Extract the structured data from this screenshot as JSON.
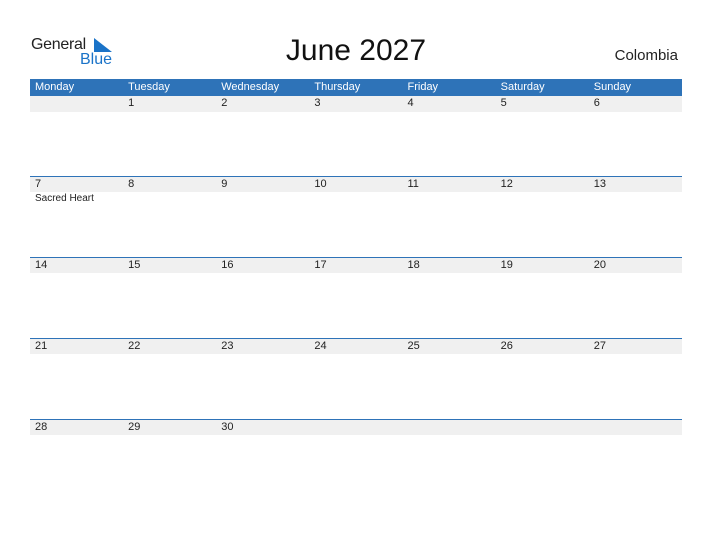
{
  "logo": {
    "general": "General",
    "blue": "Blue",
    "accent": "#1a73c8"
  },
  "title": "June 2027",
  "country": "Colombia",
  "colors": {
    "header_bg": "#2e73b8",
    "row_bg": "#f0f0f0"
  },
  "weekdays": [
    "Monday",
    "Tuesday",
    "Wednesday",
    "Thursday",
    "Friday",
    "Saturday",
    "Sunday"
  ],
  "weeks": [
    {
      "days": [
        "",
        "1",
        "2",
        "3",
        "4",
        "5",
        "6"
      ],
      "events": [
        "",
        "",
        "",
        "",
        "",
        "",
        ""
      ]
    },
    {
      "days": [
        "7",
        "8",
        "9",
        "10",
        "11",
        "12",
        "13"
      ],
      "events": [
        "Sacred Heart",
        "",
        "",
        "",
        "",
        "",
        ""
      ]
    },
    {
      "days": [
        "14",
        "15",
        "16",
        "17",
        "18",
        "19",
        "20"
      ],
      "events": [
        "",
        "",
        "",
        "",
        "",
        "",
        ""
      ]
    },
    {
      "days": [
        "21",
        "22",
        "23",
        "24",
        "25",
        "26",
        "27"
      ],
      "events": [
        "",
        "",
        "",
        "",
        "",
        "",
        ""
      ]
    },
    {
      "days": [
        "28",
        "29",
        "30",
        "",
        "",
        "",
        ""
      ],
      "events": [
        "",
        "",
        "",
        "",
        "",
        "",
        ""
      ]
    }
  ]
}
